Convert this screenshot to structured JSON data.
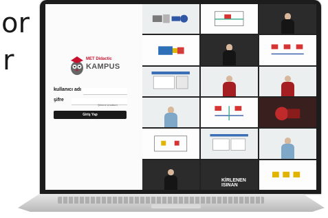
{
  "outer_text": {
    "line1": "or",
    "line2": "r"
  },
  "brand": {
    "line1": "MET Didactic",
    "line2": "KAMPUS"
  },
  "login": {
    "username_label": "kullanıcı adı",
    "password_label": "şifre",
    "forgot_label": "Şifremi Unuttum",
    "submit_label": "Giriş Yap"
  },
  "video_tiles": {
    "kirlenen": "KİRLENEN",
    "isinan": "ISINAN"
  },
  "colors": {
    "brand_red": "#c8102e",
    "button_dark": "#1a1a1a"
  }
}
